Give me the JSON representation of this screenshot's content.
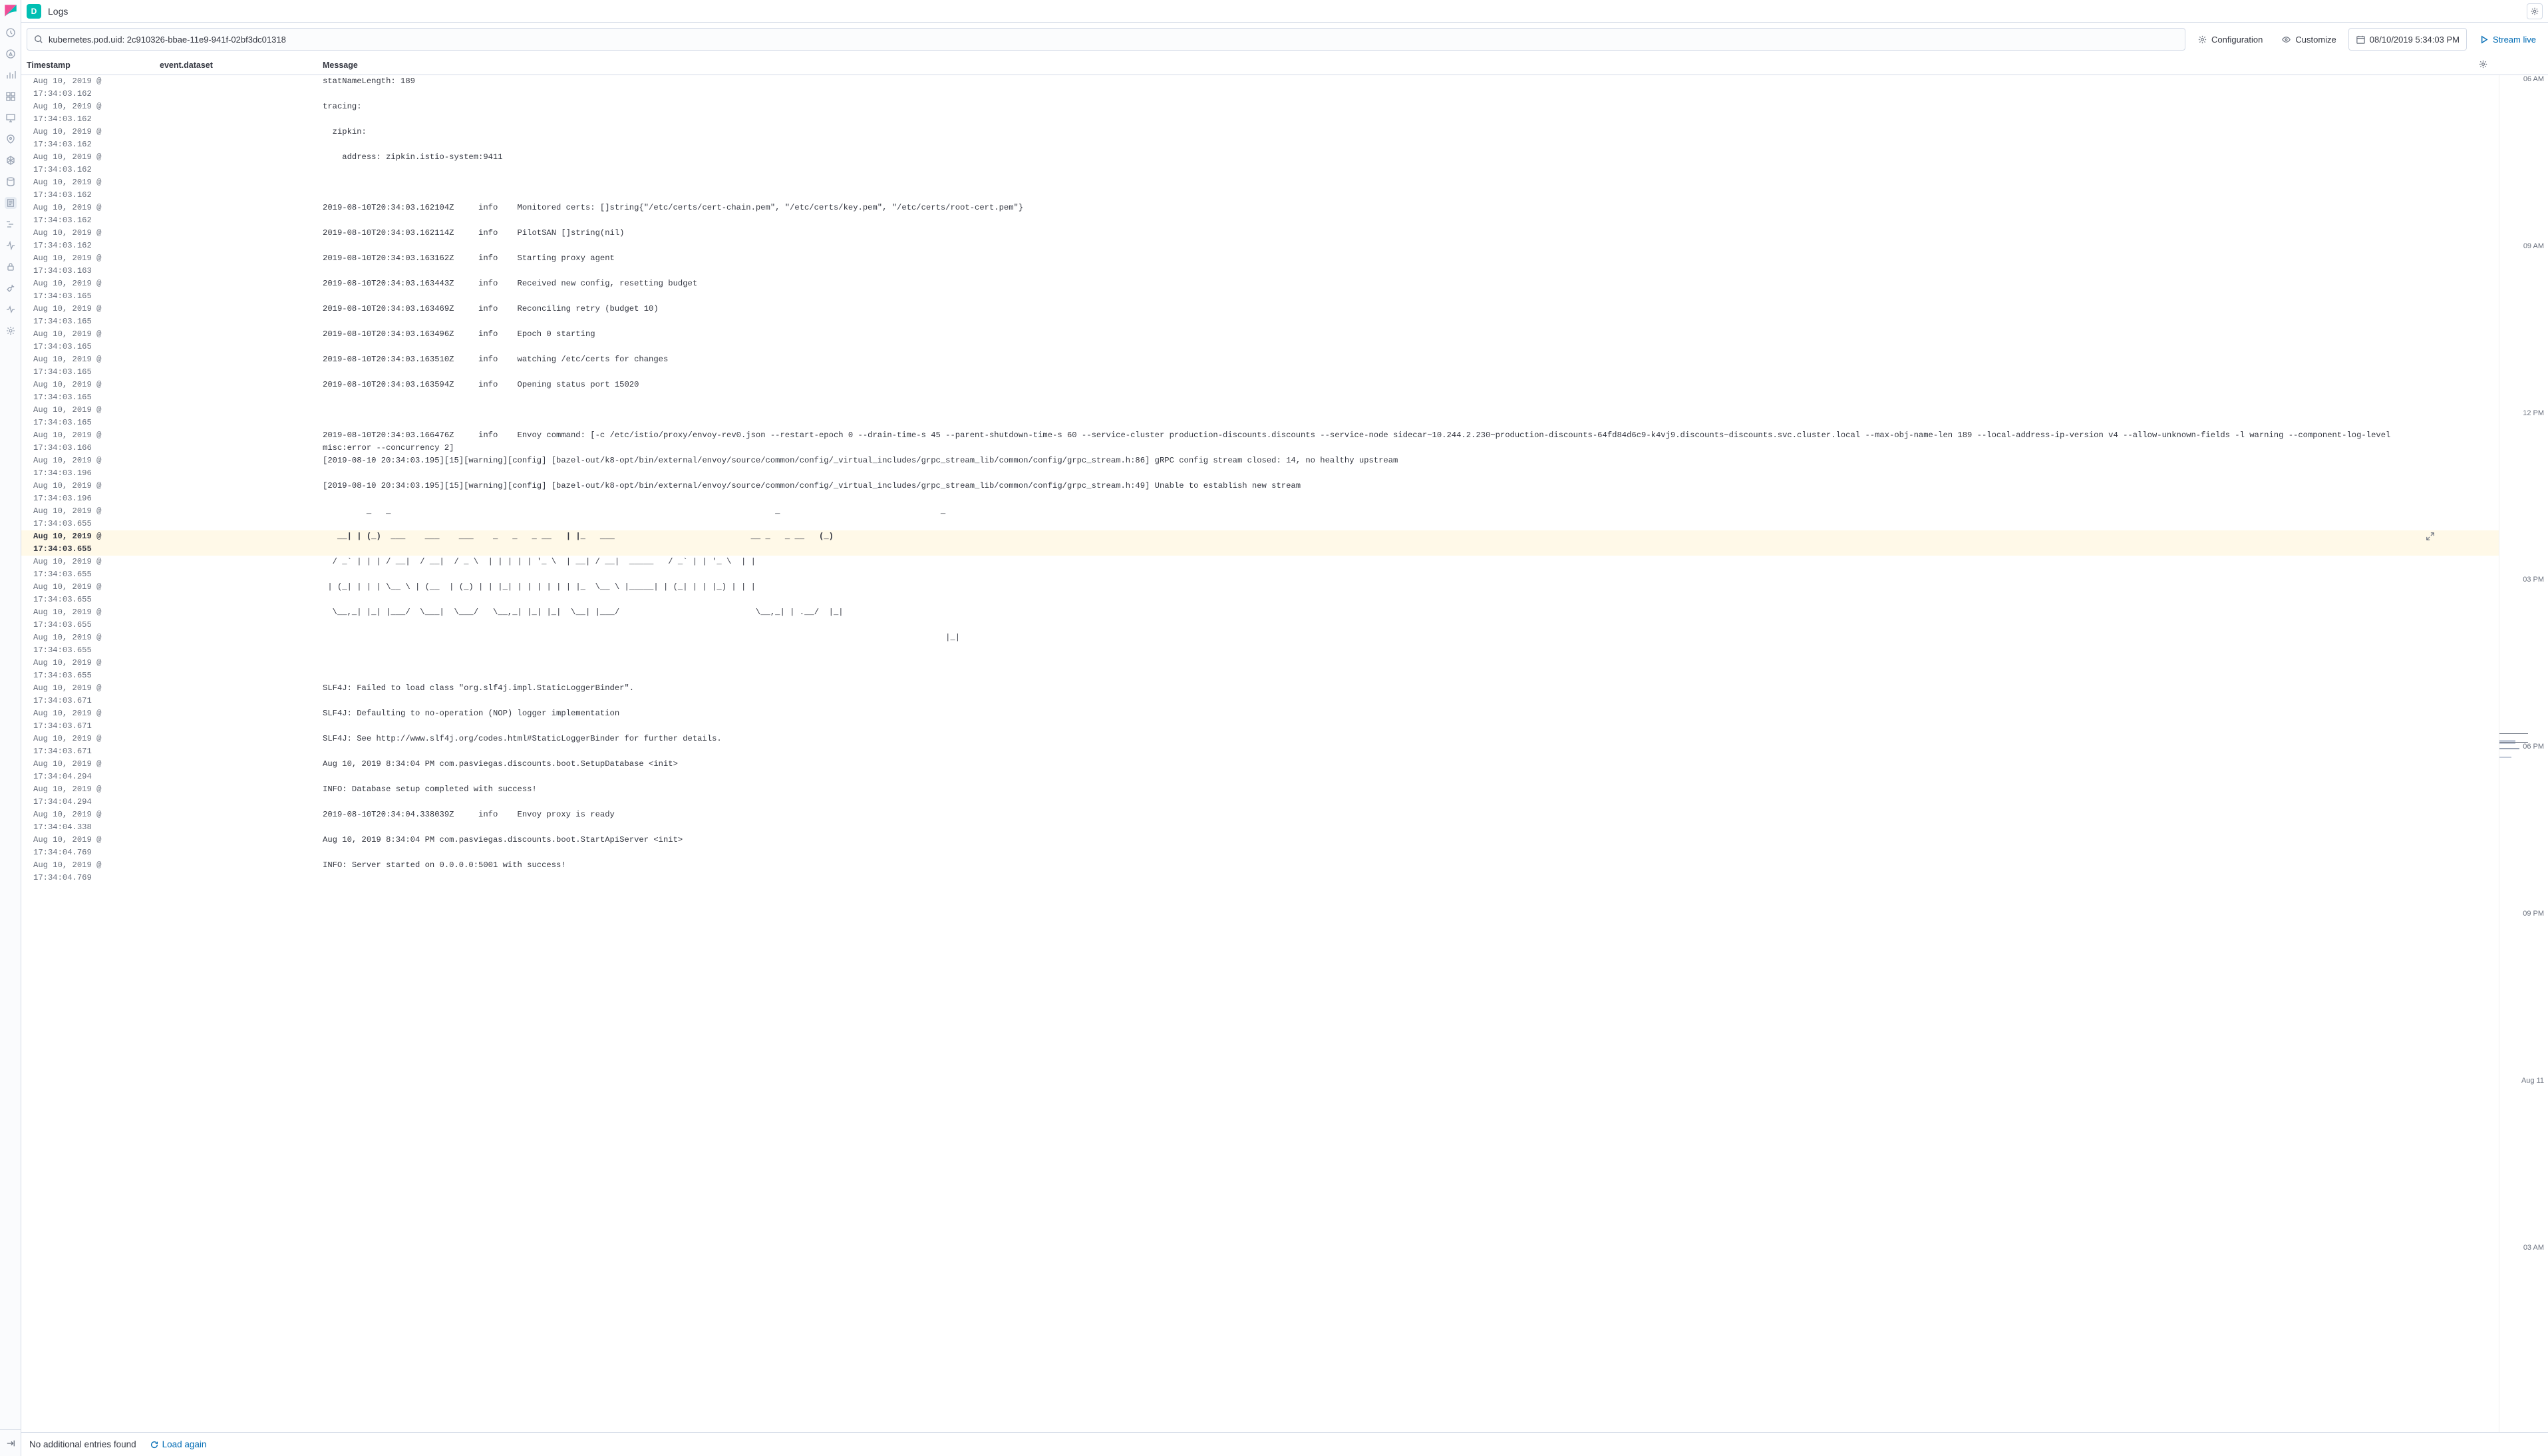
{
  "header": {
    "space_initial": "D",
    "breadcrumb": "Logs"
  },
  "toolbar": {
    "search_value": "kubernetes.pod.uid: 2c910326-bbae-11e9-941f-02bf3dc01318",
    "configuration_label": "Configuration",
    "customize_label": "Customize",
    "datetime_label": "08/10/2019 5:34:03 PM",
    "stream_label": "Stream live"
  },
  "columns": {
    "timestamp": "Timestamp",
    "dataset": "event.dataset",
    "message": "Message"
  },
  "footer": {
    "status": "No additional entries found",
    "load_again": "Load again"
  },
  "minimap_ticks": [
    {
      "label": "06 AM",
      "top_pct": 0
    },
    {
      "label": "09 AM",
      "top_pct": 12.3
    },
    {
      "label": "12 PM",
      "top_pct": 24.6
    },
    {
      "label": "03 PM",
      "top_pct": 36.9
    },
    {
      "label": "06 PM",
      "top_pct": 49.2
    },
    {
      "label": "09 PM",
      "top_pct": 61.5
    },
    {
      "label": "Aug 11",
      "top_pct": 73.8
    },
    {
      "label": "03 AM",
      "top_pct": 86.1
    }
  ],
  "rows": [
    {
      "ts": "Aug 10, 2019 @ 17:34:03.162",
      "msg": "statNameLength: 189"
    },
    {
      "ts": "Aug 10, 2019 @ 17:34:03.162",
      "msg": "tracing:"
    },
    {
      "ts": "Aug 10, 2019 @ 17:34:03.162",
      "msg": "  zipkin:"
    },
    {
      "ts": "Aug 10, 2019 @ 17:34:03.162",
      "msg": "    address: zipkin.istio-system:9411"
    },
    {
      "ts": "Aug 10, 2019 @ 17:34:03.162",
      "msg": ""
    },
    {
      "ts": "Aug 10, 2019 @ 17:34:03.162",
      "msg": "2019-08-10T20:34:03.162104Z     info    Monitored certs: []string{\"/etc/certs/cert-chain.pem\", \"/etc/certs/key.pem\", \"/etc/certs/root-cert.pem\"}"
    },
    {
      "ts": "Aug 10, 2019 @ 17:34:03.162",
      "msg": "2019-08-10T20:34:03.162114Z     info    PilotSAN []string(nil)"
    },
    {
      "ts": "Aug 10, 2019 @ 17:34:03.163",
      "msg": "2019-08-10T20:34:03.163162Z     info    Starting proxy agent"
    },
    {
      "ts": "Aug 10, 2019 @ 17:34:03.165",
      "msg": "2019-08-10T20:34:03.163443Z     info    Received new config, resetting budget"
    },
    {
      "ts": "Aug 10, 2019 @ 17:34:03.165",
      "msg": "2019-08-10T20:34:03.163469Z     info    Reconciling retry (budget 10)"
    },
    {
      "ts": "Aug 10, 2019 @ 17:34:03.165",
      "msg": "2019-08-10T20:34:03.163496Z     info    Epoch 0 starting"
    },
    {
      "ts": "Aug 10, 2019 @ 17:34:03.165",
      "msg": "2019-08-10T20:34:03.163510Z     info    watching /etc/certs for changes"
    },
    {
      "ts": "Aug 10, 2019 @ 17:34:03.165",
      "msg": "2019-08-10T20:34:03.163594Z     info    Opening status port 15020"
    },
    {
      "ts": "Aug 10, 2019 @ 17:34:03.165",
      "msg": ""
    },
    {
      "ts": "Aug 10, 2019 @ 17:34:03.166",
      "msg": "2019-08-10T20:34:03.166476Z     info    Envoy command: [-c /etc/istio/proxy/envoy-rev0.json --restart-epoch 0 --drain-time-s 45 --parent-shutdown-time-s 60 --service-cluster production-discounts.discounts --service-node sidecar~10.244.2.230~production-discounts-64fd84d6c9-k4vj9.discounts~discounts.svc.cluster.local --max-obj-name-len 189 --local-address-ip-version v4 --allow-unknown-fields -l warning --component-log-level misc:error --concurrency 2]"
    },
    {
      "ts": "Aug 10, 2019 @ 17:34:03.196",
      "msg": "[2019-08-10 20:34:03.195][15][warning][config] [bazel-out/k8-opt/bin/external/envoy/source/common/config/_virtual_includes/grpc_stream_lib/common/config/grpc_stream.h:86] gRPC config stream closed: 14, no healthy upstream"
    },
    {
      "ts": "Aug 10, 2019 @ 17:34:03.196",
      "msg": "[2019-08-10 20:34:03.195][15][warning][config] [bazel-out/k8-opt/bin/external/envoy/source/common/config/_virtual_includes/grpc_stream_lib/common/config/grpc_stream.h:49] Unable to establish new stream"
    },
    {
      "ts": "Aug 10, 2019 @ 17:34:03.655",
      "msg": "         _   _                                                                               _                                 _          "
    },
    {
      "ts": "Aug 10, 2019 @ 17:34:03.655",
      "msg": "   __| | (_)  ___    ___    ___    _   _   _ __   | |_   ___                            __ _   _ __   (_)",
      "hl": true
    },
    {
      "ts": "Aug 10, 2019 @ 17:34:03.655",
      "msg": "  / _` | | | / __|  / __|  / _ \\  | | | | | '_ \\  | __| / __|  _____   / _` | | '_ \\  | |"
    },
    {
      "ts": "Aug 10, 2019 @ 17:34:03.655",
      "msg": " | (_| | | | \\__ \\ | (__  | (_) | | |_| | | | | | | |_  \\__ \\ |_____| | (_| | | |_) | | |"
    },
    {
      "ts": "Aug 10, 2019 @ 17:34:03.655",
      "msg": "  \\__,_| |_| |___/  \\___|  \\___/   \\__,_| |_| |_|  \\__| |___/                            \\__,_| | .__/  |_|"
    },
    {
      "ts": "Aug 10, 2019 @ 17:34:03.655",
      "msg": "                                                                                                                                |_|        "
    },
    {
      "ts": "Aug 10, 2019 @ 17:34:03.655",
      "msg": ""
    },
    {
      "ts": "Aug 10, 2019 @ 17:34:03.671",
      "msg": "SLF4J: Failed to load class \"org.slf4j.impl.StaticLoggerBinder\"."
    },
    {
      "ts": "Aug 10, 2019 @ 17:34:03.671",
      "msg": "SLF4J: Defaulting to no-operation (NOP) logger implementation"
    },
    {
      "ts": "Aug 10, 2019 @ 17:34:03.671",
      "msg": "SLF4J: See http://www.slf4j.org/codes.html#StaticLoggerBinder for further details."
    },
    {
      "ts": "Aug 10, 2019 @ 17:34:04.294",
      "msg": "Aug 10, 2019 8:34:04 PM com.pasviegas.discounts.boot.SetupDatabase <init>"
    },
    {
      "ts": "Aug 10, 2019 @ 17:34:04.294",
      "msg": "INFO: Database setup completed with success!"
    },
    {
      "ts": "Aug 10, 2019 @ 17:34:04.338",
      "msg": "2019-08-10T20:34:04.338039Z     info    Envoy proxy is ready"
    },
    {
      "ts": "Aug 10, 2019 @ 17:34:04.769",
      "msg": "Aug 10, 2019 8:34:04 PM com.pasviegas.discounts.boot.StartApiServer <init>"
    },
    {
      "ts": "Aug 10, 2019 @ 17:34:04.769",
      "msg": "INFO: Server started on 0.0.0.0:5001 with success!"
    }
  ]
}
